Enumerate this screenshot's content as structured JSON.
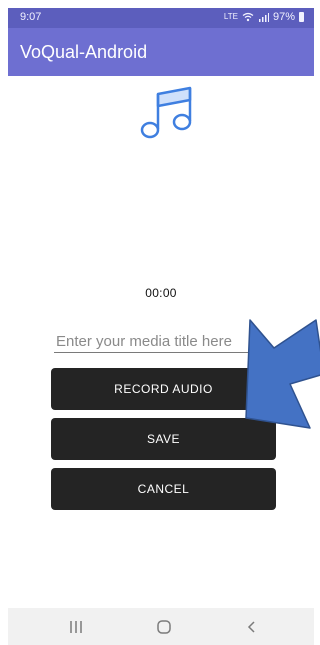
{
  "status_bar": {
    "time": "9:07",
    "network": "LTE",
    "battery": "97%",
    "icons": [
      "volte-icon",
      "wifi-icon",
      "signal-icon",
      "battery-icon"
    ]
  },
  "app_bar": {
    "title": "VoQual-Android",
    "color": "#6e6fd1"
  },
  "main": {
    "media_icon": "music-note-icon",
    "timer": "00:00",
    "title_input": {
      "value": "",
      "placeholder": "Enter your media title here"
    },
    "buttons": {
      "record": "RECORD AUDIO",
      "save": "SAVE",
      "cancel": "CANCEL"
    },
    "button_color": "#242424",
    "annotation_arrow_color": "#4472c4"
  },
  "nav_bar": {
    "items": [
      "recent-apps-icon",
      "home-icon",
      "back-icon"
    ]
  }
}
